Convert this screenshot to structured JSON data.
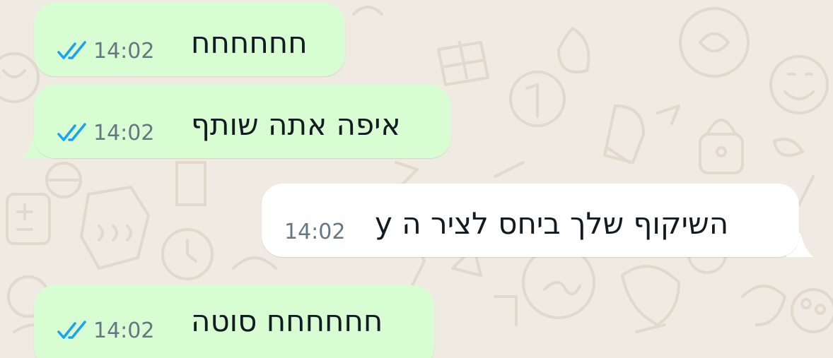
{
  "colors": {
    "background": "#efeae2",
    "outgoing_bubble": "#d9fdd3",
    "incoming_bubble": "#ffffff",
    "text": "#111b21",
    "timestamp": "#667781",
    "read_receipt": "#1aa2f5",
    "wallpaper_doodle": "#e2d8cc"
  },
  "messages": [
    {
      "direction": "outgoing",
      "text": "חחחחחח",
      "time": "14:02",
      "status_icon": "double-check-read-icon"
    },
    {
      "direction": "outgoing",
      "text": "איפה אתה שותף",
      "time": "14:02",
      "status_icon": "double-check-read-icon"
    },
    {
      "direction": "incoming",
      "text": "השיקוף שלך ביחס לציר ה y",
      "time": "14:02"
    },
    {
      "direction": "outgoing",
      "text": "חחחחחח סוטה",
      "time": "14:02",
      "status_icon": "double-check-read-icon"
    }
  ]
}
